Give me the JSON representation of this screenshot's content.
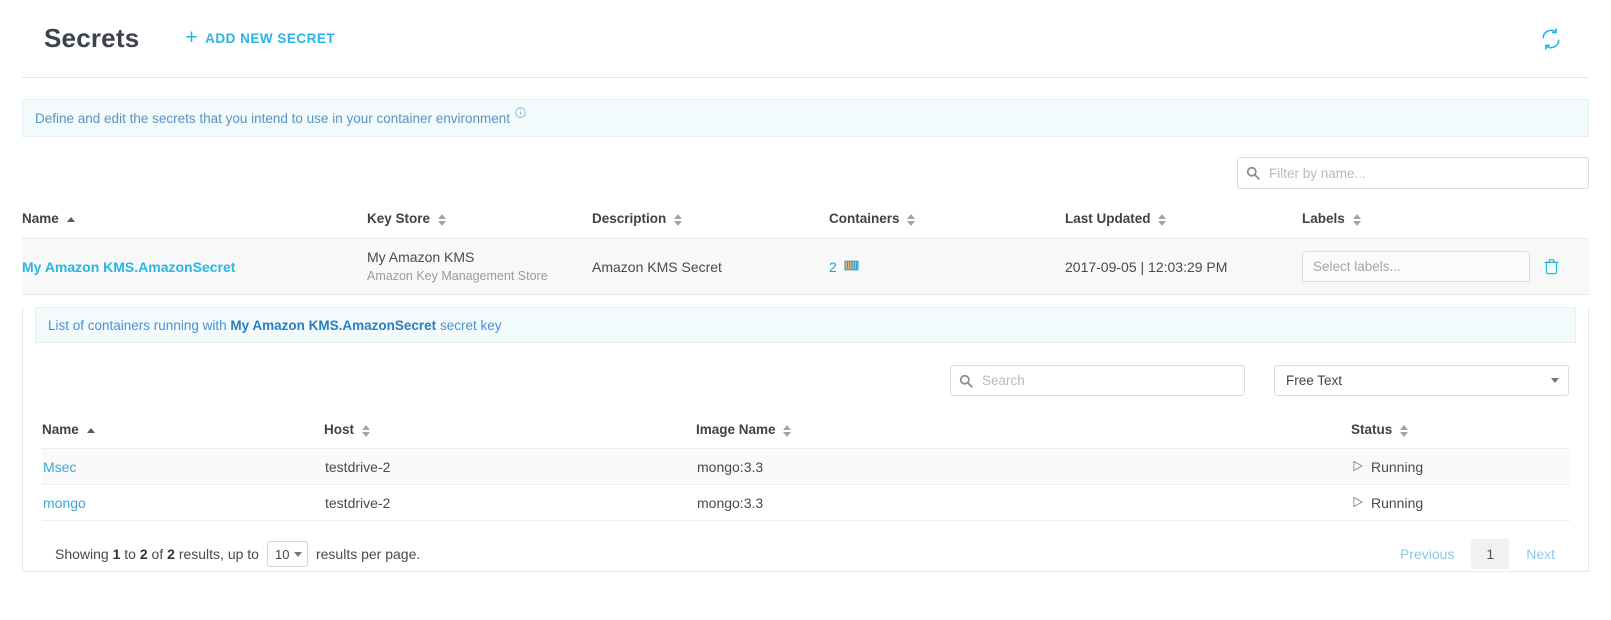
{
  "header": {
    "title": "Secrets",
    "add_new_label": "ADD NEW SECRET",
    "plus_icon": "plus-icon",
    "refresh_icon": "refresh-icon"
  },
  "info_banner": {
    "text": "Define and edit the secrets that you intend to use in your container environment",
    "icon": "info-circle-icon"
  },
  "filter": {
    "placeholder": "Filter by name...",
    "value": "",
    "icon": "search-icon"
  },
  "secrets_table": {
    "columns": [
      {
        "label": "Name",
        "sort": "asc"
      },
      {
        "label": "Key Store",
        "sort": "none"
      },
      {
        "label": "Description",
        "sort": "none"
      },
      {
        "label": "Containers",
        "sort": "none"
      },
      {
        "label": "Last Updated",
        "sort": "none"
      },
      {
        "label": "Labels",
        "sort": "none"
      }
    ],
    "rows": [
      {
        "name": "My Amazon KMS.AmazonSecret",
        "key_store_name": "My Amazon KMS",
        "key_store_type": "Amazon Key Management Store",
        "description": "Amazon KMS Secret",
        "containers_count": "2",
        "containers_icon": "container-icon",
        "last_updated": "2017-09-05 | 12:03:29 PM",
        "labels_placeholder": "Select labels...",
        "delete_icon": "trash-icon"
      }
    ]
  },
  "sub_panel": {
    "banner_prefix": "List of containers running with",
    "banner_secret": "My Amazon KMS.AmazonSecret",
    "banner_suffix": "secret key",
    "search": {
      "placeholder": "Search",
      "value": "",
      "icon": "search-icon"
    },
    "filter_select": {
      "value": "Free Text",
      "caret_icon": "chevron-down-icon"
    },
    "columns": [
      {
        "label": "Name",
        "sort": "asc"
      },
      {
        "label": "Host",
        "sort": "none"
      },
      {
        "label": "Image Name",
        "sort": "none"
      },
      {
        "label": "Status",
        "sort": "none"
      }
    ],
    "rows": [
      {
        "name": "Msec",
        "host": "testdrive-2",
        "image_name": "mongo:3.3",
        "status": "Running",
        "status_icon": "play-outline-icon"
      },
      {
        "name": "mongo",
        "host": "testdrive-2",
        "image_name": "mongo:3.3",
        "status": "Running",
        "status_icon": "play-outline-icon"
      }
    ],
    "pagination": {
      "showing_prefix": "Showing",
      "from": "1",
      "to_word": "to",
      "to": "2",
      "of_word": "of",
      "total": "2",
      "results_word": "results, up to",
      "per_page": "10",
      "per_page_suffix": "results per page.",
      "previous_label": "Previous",
      "current_page": "1",
      "next_label": "Next"
    }
  },
  "colors": {
    "accent": "#29b6e5",
    "banner_bg": "#f2fafb",
    "link_blue": "#4a90d9",
    "title": "#3d4349"
  }
}
